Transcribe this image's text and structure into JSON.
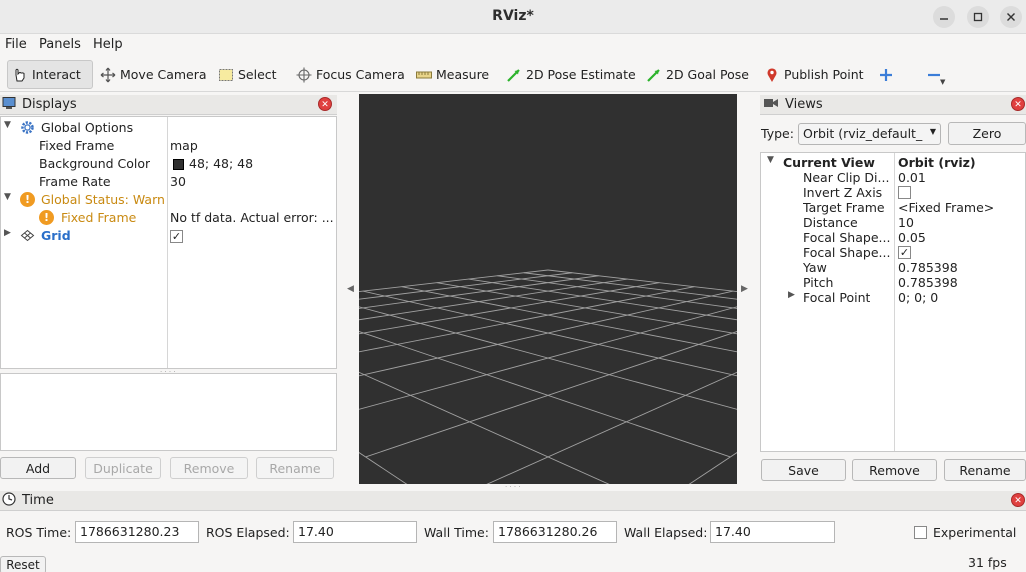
{
  "window": {
    "title": "RViz*",
    "minimize_icon": "minimize-icon",
    "maximize_icon": "maximize-icon",
    "close_icon": "close-icon"
  },
  "menu": [
    "File",
    "Panels",
    "Help"
  ],
  "toolbar": {
    "interact": "Interact",
    "move_camera": "Move Camera",
    "select": "Select",
    "focus_camera": "Focus Camera",
    "measure": "Measure",
    "pose_estimate": "2D Pose Estimate",
    "goal_pose": "2D Goal Pose",
    "publish_point": "Publish Point"
  },
  "displays": {
    "title": "Displays",
    "global_options": "Global Options",
    "fixed_frame_label": "Fixed Frame",
    "fixed_frame_value": "map",
    "bg_color_label": "Background Color",
    "bg_color_value": "48; 48; 48",
    "bg_color_swatch": "#303030",
    "frame_rate_label": "Frame Rate",
    "frame_rate_value": "30",
    "global_status": "Global Status: Warn",
    "fixed_frame_warn_label": "Fixed Frame",
    "fixed_frame_warn_value": "No tf data.  Actual error: ...",
    "grid_label": "Grid",
    "grid_checked": "✓",
    "add": "Add",
    "duplicate": "Duplicate",
    "remove": "Remove",
    "rename": "Rename",
    "warn_color": "#c98a12",
    "link_color": "#2a6fc9"
  },
  "views": {
    "title": "Views",
    "type_label": "Type:",
    "type_value": "Orbit (rviz_default_",
    "zero": "Zero",
    "current_view_label": "Current View",
    "current_view_value": "Orbit (rviz)",
    "props": [
      {
        "label": "Near Clip Di...",
        "value": "0.01"
      },
      {
        "label": "Invert Z Axis",
        "value": ""
      },
      {
        "label": "Target Frame",
        "value": "<Fixed Frame>"
      },
      {
        "label": "Distance",
        "value": "10"
      },
      {
        "label": "Focal Shape...",
        "value": "0.05"
      },
      {
        "label": "Focal Shape...",
        "value": "✓"
      },
      {
        "label": "Yaw",
        "value": "0.785398"
      },
      {
        "label": "Pitch",
        "value": "0.785398"
      },
      {
        "label": "Focal Point",
        "value": "0; 0; 0"
      }
    ],
    "save": "Save",
    "remove": "Remove",
    "rename": "Rename"
  },
  "time": {
    "title": "Time",
    "ros_time_label": "ROS Time:",
    "ros_time_value": "1786631280.23",
    "ros_elapsed_label": "ROS Elapsed:",
    "ros_elapsed_value": "17.40",
    "wall_time_label": "Wall Time:",
    "wall_time_value": "1786631280.26",
    "wall_elapsed_label": "Wall Elapsed:",
    "wall_elapsed_value": "17.40",
    "experimental": "Experimental",
    "reset": "Reset",
    "fps": "31 fps"
  },
  "colors": {
    "viewport_bg": "#303030",
    "grid_line": "#a0a0a0"
  }
}
